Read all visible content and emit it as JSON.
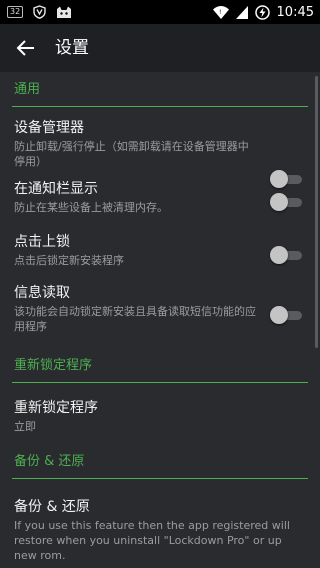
{
  "status_bar": {
    "badge": "32",
    "time": "10:45"
  },
  "app_bar": {
    "title": "设置"
  },
  "sections": {
    "general": {
      "header": "通用",
      "device_admin": {
        "title": "设备管理器",
        "summary": "防止卸载/强行停止（如需卸载请在设备管理器中停用）",
        "checked": false
      },
      "notification": {
        "title": "在通知栏显示",
        "summary": "防止在某些设备上被清理内存。",
        "checked": false
      },
      "click_lock": {
        "title": "点击上锁",
        "summary": "点击后锁定新安装程序",
        "checked": false
      },
      "sms": {
        "title": "信息读取",
        "summary": "该功能会自动锁定新安装且具备读取短信功能的应用程序",
        "checked": false
      }
    },
    "relock": {
      "header": "重新锁定程序",
      "item": {
        "title": "重新锁定程序",
        "summary": "立即"
      }
    },
    "backup": {
      "header": "备份 & 还原",
      "item": {
        "title": "备份 & 还原",
        "summary": "If you use this feature then the app registered will restore when you uninstall \"Lockdown Pro\" or up new rom."
      }
    }
  },
  "colors": {
    "accent": "#4caf50",
    "background": "#2a2b2f",
    "app_bar": "#1f2024",
    "status_bar": "#000000"
  }
}
